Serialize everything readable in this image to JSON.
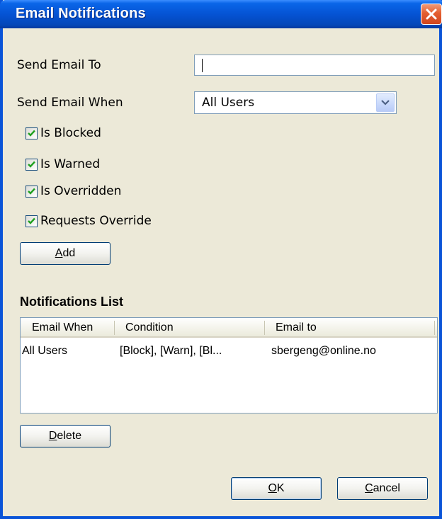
{
  "window": {
    "title": "Email Notifications"
  },
  "form": {
    "send_to_label": "Send Email To",
    "send_to_value": "",
    "send_when_label": "Send Email When",
    "send_when_value": "All Users"
  },
  "checkboxes": [
    {
      "label": "Is Blocked",
      "checked": true
    },
    {
      "label": "Is Warned",
      "checked": true
    },
    {
      "label": "Is Overridden",
      "checked": true
    },
    {
      "label": "Requests Override",
      "checked": true
    }
  ],
  "buttons": {
    "add_first": "A",
    "add_rest": "dd",
    "delete_first": "D",
    "delete_rest": "elete",
    "ok_first": "O",
    "ok_rest": "K",
    "cancel_first": "C",
    "cancel_rest": "ancel"
  },
  "notifications": {
    "title": "Notifications List",
    "columns": [
      "Email When",
      "Condition",
      "Email to"
    ],
    "rows": [
      {
        "email_when": "All Users",
        "condition": "[Block], [Warn], [Bl...",
        "email_to": "sbergeng@online.no"
      }
    ]
  },
  "colors": {
    "titlebar": "#0553d4",
    "dialog_bg": "#ece9d8",
    "check": "#21a121"
  }
}
